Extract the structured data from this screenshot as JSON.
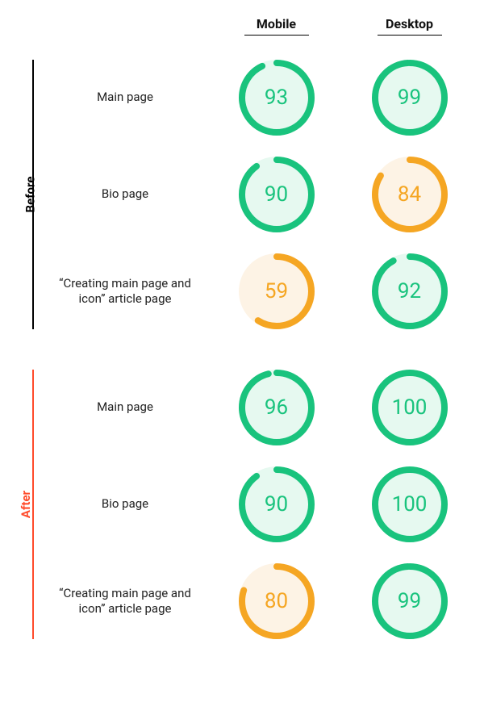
{
  "columns": {
    "mobile": "Mobile",
    "desktop": "Desktop"
  },
  "colors": {
    "green": "#19c37d",
    "orange": "#f5a623",
    "after_accent": "#ff4b2b",
    "before_accent": "#000000"
  },
  "sections": {
    "before": {
      "label": "Before",
      "rows": [
        {
          "label": "Main page",
          "mobile": {
            "value": 93,
            "tier": "green"
          },
          "desktop": {
            "value": 99,
            "tier": "green"
          }
        },
        {
          "label": "Bio page",
          "mobile": {
            "value": 90,
            "tier": "green"
          },
          "desktop": {
            "value": 84,
            "tier": "orange"
          }
        },
        {
          "label": "“Creating main page and icon” article page",
          "mobile": {
            "value": 59,
            "tier": "orange"
          },
          "desktop": {
            "value": 92,
            "tier": "green"
          }
        }
      ]
    },
    "after": {
      "label": "After",
      "rows": [
        {
          "label": "Main page",
          "mobile": {
            "value": 96,
            "tier": "green"
          },
          "desktop": {
            "value": 100,
            "tier": "green"
          }
        },
        {
          "label": "Bio page",
          "mobile": {
            "value": 90,
            "tier": "green"
          },
          "desktop": {
            "value": 100,
            "tier": "green"
          }
        },
        {
          "label": "“Creating main page and icon” article page",
          "mobile": {
            "value": 80,
            "tier": "orange"
          },
          "desktop": {
            "value": 99,
            "tier": "green"
          }
        }
      ]
    }
  },
  "chart_data": {
    "type": "table",
    "title": "",
    "columns": [
      "Mobile",
      "Desktop"
    ],
    "groups": [
      "Before",
      "After"
    ],
    "rows": [
      "Main page",
      "Bio page",
      "“Creating main page and icon” article page"
    ],
    "values": {
      "Before": {
        "Main page": {
          "Mobile": 93,
          "Desktop": 99
        },
        "Bio page": {
          "Mobile": 90,
          "Desktop": 84
        },
        "“Creating main page and icon” article page": {
          "Mobile": 59,
          "Desktop": 92
        }
      },
      "After": {
        "Main page": {
          "Mobile": 96,
          "Desktop": 100
        },
        "Bio page": {
          "Mobile": 90,
          "Desktop": 100
        },
        "“Creating main page and icon” article page": {
          "Mobile": 80,
          "Desktop": 99
        }
      }
    },
    "ylim": [
      0,
      100
    ]
  }
}
